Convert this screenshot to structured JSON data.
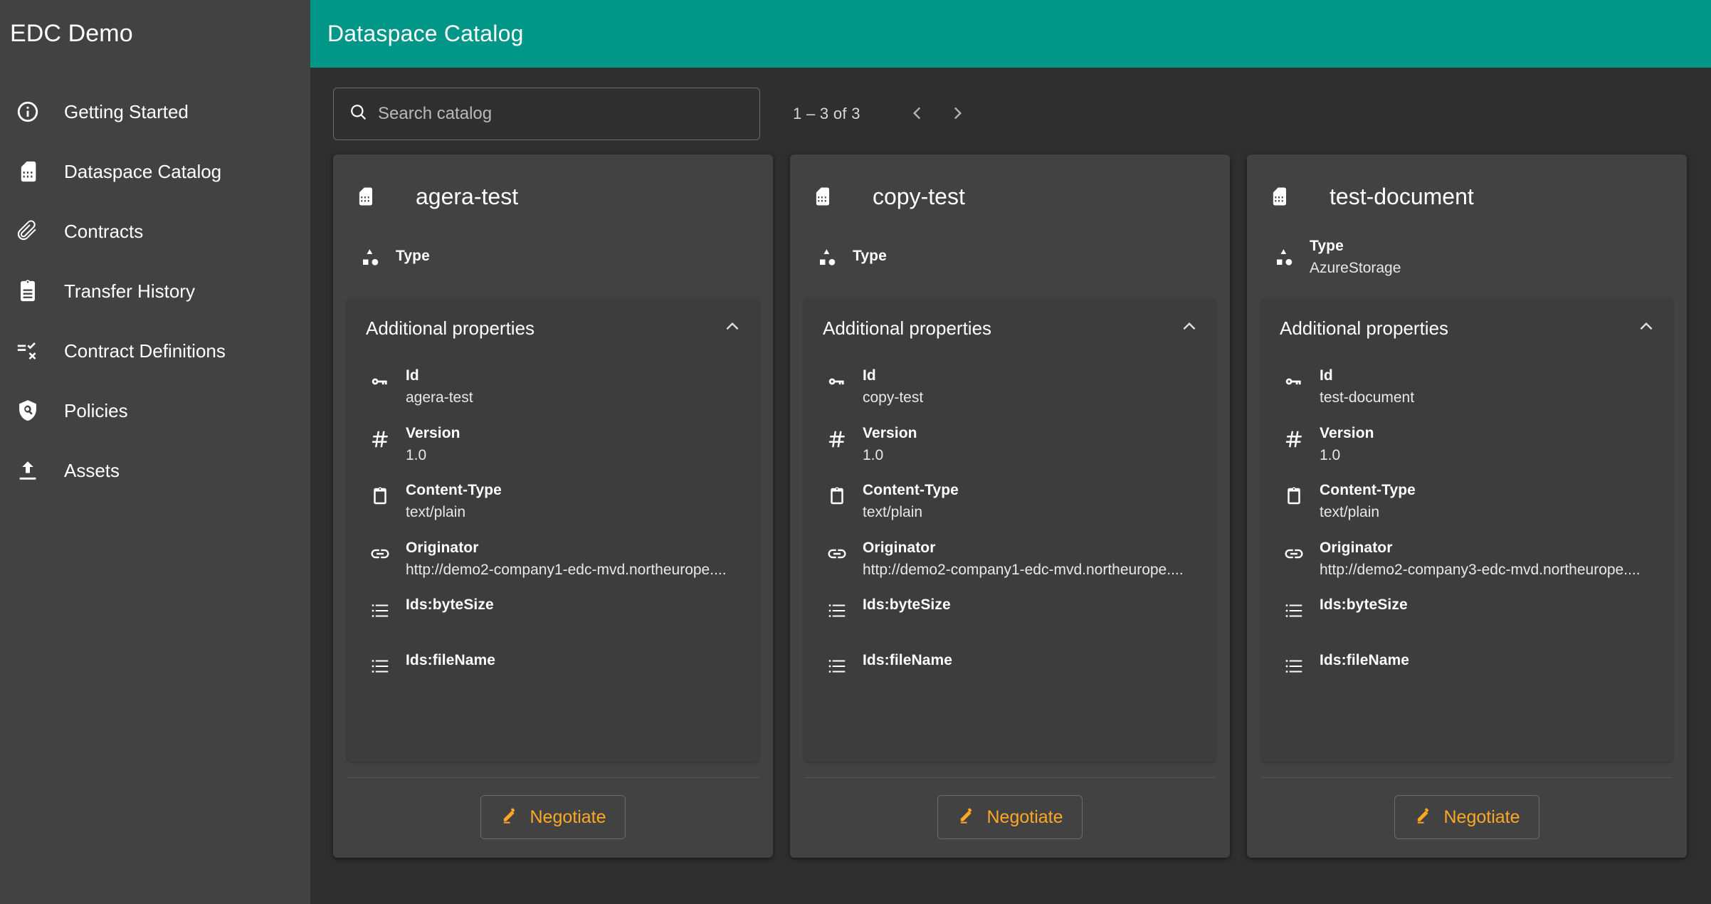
{
  "app": {
    "brand": "EDC Demo",
    "accent_teal": "#009688",
    "accent_orange": "#ffa726",
    "sidebar_bg": "#424242",
    "content_bg": "#2f2f2f",
    "card_bg": "#424242",
    "panel_bg": "#3d3d3d"
  },
  "sidebar": {
    "items": [
      {
        "label": "Getting Started",
        "icon": "info-circle-icon"
      },
      {
        "label": "Dataspace Catalog",
        "icon": "sim-card-icon"
      },
      {
        "label": "Contracts",
        "icon": "paperclip-icon"
      },
      {
        "label": "Transfer History",
        "icon": "clipboard-list-icon"
      },
      {
        "label": "Contract Definitions",
        "icon": "rule-icon"
      },
      {
        "label": "Policies",
        "icon": "shield-search-icon"
      },
      {
        "label": "Assets",
        "icon": "upload-icon"
      }
    ]
  },
  "header": {
    "title": "Dataspace Catalog"
  },
  "toolbar": {
    "search": {
      "placeholder": "Search catalog",
      "value": "",
      "icon": "search-icon"
    },
    "paginator": {
      "range_label": "1 – 3 of 3",
      "prev_icon": "chevron-left-icon",
      "next_icon": "chevron-right-icon"
    }
  },
  "labels": {
    "type": "Type",
    "additional_properties": "Additional properties",
    "id": "Id",
    "version": "Version",
    "content_type": "Content-Type",
    "originator": "Originator",
    "ids_byte_size": "Ids:byteSize",
    "ids_file_name": "Ids:fileName",
    "negotiate": "Negotiate",
    "collapse_icon": "chevron-up-icon",
    "pencil_icon": "pencil-icon"
  },
  "cards": [
    {
      "title": "agera-test",
      "icon": "sim-card-icon",
      "type_value": "",
      "properties": {
        "id": "agera-test",
        "version": "1.0",
        "content_type": "text/plain",
        "originator": "http://demo2-company1-edc-mvd.northeurope....",
        "ids_byte_size": "",
        "ids_file_name": ""
      }
    },
    {
      "title": "copy-test",
      "icon": "sim-card-icon",
      "type_value": "",
      "properties": {
        "id": "copy-test",
        "version": "1.0",
        "content_type": "text/plain",
        "originator": "http://demo2-company1-edc-mvd.northeurope....",
        "ids_byte_size": "",
        "ids_file_name": ""
      }
    },
    {
      "title": "test-document",
      "icon": "sim-card-icon",
      "type_value": "AzureStorage",
      "properties": {
        "id": "test-document",
        "version": "1.0",
        "content_type": "text/plain",
        "originator": "http://demo2-company3-edc-mvd.northeurope....",
        "ids_byte_size": "",
        "ids_file_name": ""
      }
    }
  ]
}
